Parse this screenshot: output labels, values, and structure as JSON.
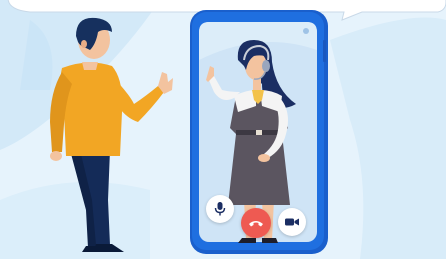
{
  "illustration": {
    "subject": "video-call-with-support-agent",
    "icons": {
      "mute": "microphone-icon",
      "hangup": "phone-hangup-icon",
      "camera": "video-camera-icon"
    },
    "colors": {
      "background": "#e6f3fc",
      "speech_bubble": "#ffffff",
      "phone_frame": "#1f6fe0",
      "phone_screen": "#cfe4f6",
      "man_sweater": "#f2a624",
      "man_pants": "#142b58",
      "agent_dress": "#5b5560",
      "hangup_button": "#ee5a52"
    }
  }
}
